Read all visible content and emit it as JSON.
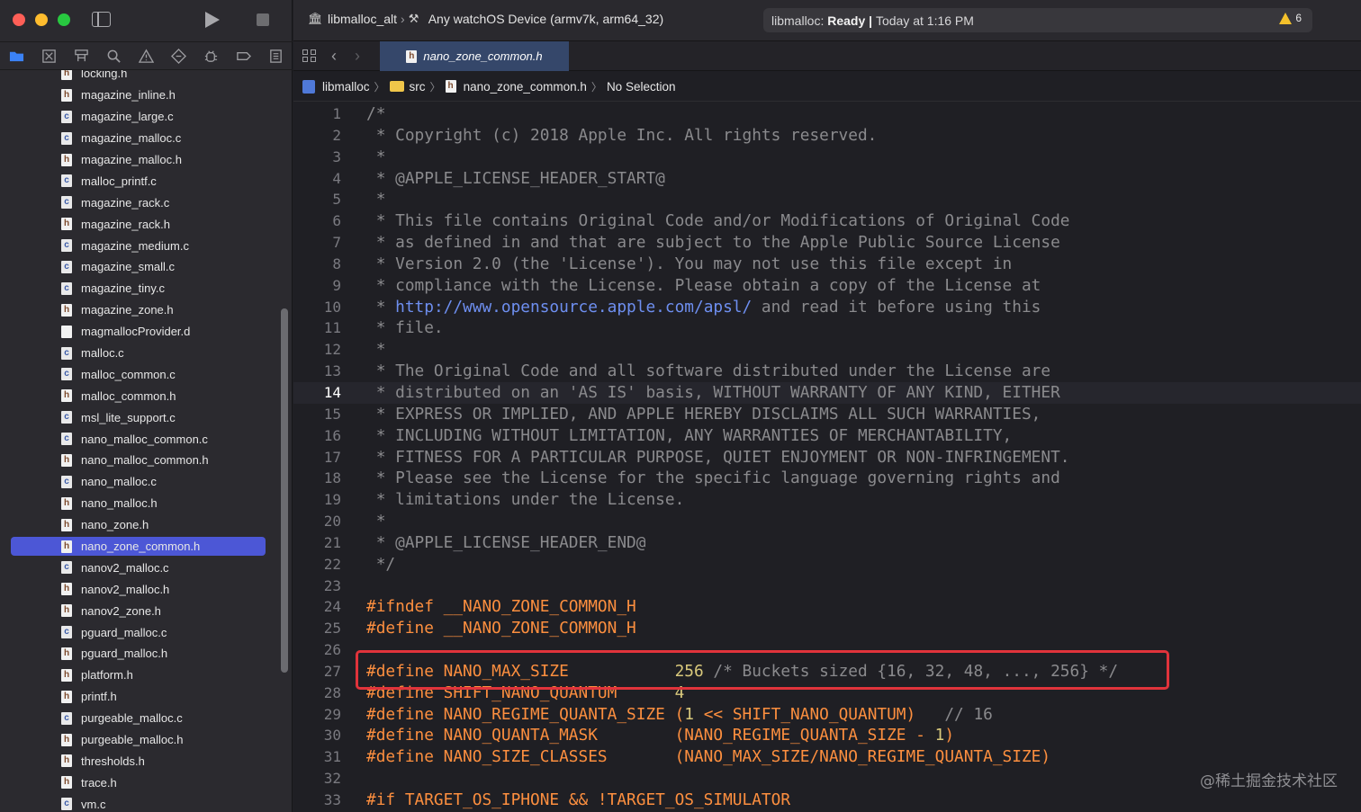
{
  "window": {
    "scheme_project": "libmalloc_alt",
    "scheme_device": "Any watchOS Device (armv7k, arm64_32)",
    "status_project": "libmalloc:",
    "status_state": "Ready",
    "status_separator": "|",
    "status_time": "Today at 1:16 PM",
    "warning_count": "6"
  },
  "icons": {
    "close": "close-dot",
    "minimize": "minimize-dot",
    "maximize": "maximize-dot",
    "sidebar": "sidebar-icon",
    "run": "play-icon",
    "stop": "stop-icon",
    "navigator_tabs": [
      "folder-icon",
      "source-control-icon",
      "symbol-icon",
      "search-icon",
      "issue-icon",
      "test-icon",
      "debug-icon",
      "breakpoint-icon",
      "report-icon"
    ]
  },
  "sidebar": {
    "files": [
      {
        "name": "locking.h",
        "type": "h"
      },
      {
        "name": "magazine_inline.h",
        "type": "h"
      },
      {
        "name": "magazine_large.c",
        "type": "c"
      },
      {
        "name": "magazine_malloc.c",
        "type": "c"
      },
      {
        "name": "magazine_malloc.h",
        "type": "h"
      },
      {
        "name": "malloc_printf.c",
        "type": "c"
      },
      {
        "name": "magazine_rack.c",
        "type": "c"
      },
      {
        "name": "magazine_rack.h",
        "type": "h"
      },
      {
        "name": "magazine_medium.c",
        "type": "c"
      },
      {
        "name": "magazine_small.c",
        "type": "c"
      },
      {
        "name": "magazine_tiny.c",
        "type": "c"
      },
      {
        "name": "magazine_zone.h",
        "type": "h"
      },
      {
        "name": "magmallocProvider.d",
        "type": "d"
      },
      {
        "name": "malloc.c",
        "type": "c"
      },
      {
        "name": "malloc_common.c",
        "type": "c"
      },
      {
        "name": "malloc_common.h",
        "type": "h"
      },
      {
        "name": "msl_lite_support.c",
        "type": "c"
      },
      {
        "name": "nano_malloc_common.c",
        "type": "c"
      },
      {
        "name": "nano_malloc_common.h",
        "type": "h"
      },
      {
        "name": "nano_malloc.c",
        "type": "c"
      },
      {
        "name": "nano_malloc.h",
        "type": "h"
      },
      {
        "name": "nano_zone.h",
        "type": "h"
      },
      {
        "name": "nano_zone_common.h",
        "type": "h",
        "selected": true
      },
      {
        "name": "nanov2_malloc.c",
        "type": "c"
      },
      {
        "name": "nanov2_malloc.h",
        "type": "h"
      },
      {
        "name": "nanov2_zone.h",
        "type": "h"
      },
      {
        "name": "pguard_malloc.c",
        "type": "c"
      },
      {
        "name": "pguard_malloc.h",
        "type": "h"
      },
      {
        "name": "platform.h",
        "type": "h"
      },
      {
        "name": "printf.h",
        "type": "h"
      },
      {
        "name": "purgeable_malloc.c",
        "type": "c"
      },
      {
        "name": "purgeable_malloc.h",
        "type": "h"
      },
      {
        "name": "thresholds.h",
        "type": "h"
      },
      {
        "name": "trace.h",
        "type": "h"
      },
      {
        "name": "vm.c",
        "type": "c"
      }
    ]
  },
  "editor": {
    "tab_label": "nano_zone_common.h",
    "breadcrumbs": [
      "libmalloc",
      "src",
      "nano_zone_common.h",
      "No Selection"
    ],
    "current_line": 14,
    "lines": [
      [
        {
          "t": "/*",
          "c": "comment"
        }
      ],
      [
        {
          "t": " * Copyright (c) 2018 Apple Inc. All rights reserved.",
          "c": "comment"
        }
      ],
      [
        {
          "t": " *",
          "c": "comment"
        }
      ],
      [
        {
          "t": " * @APPLE_LICENSE_HEADER_START@",
          "c": "comment"
        }
      ],
      [
        {
          "t": " *",
          "c": "comment"
        }
      ],
      [
        {
          "t": " * This file contains Original Code and/or Modifications of Original Code",
          "c": "comment"
        }
      ],
      [
        {
          "t": " * as defined in and that are subject to the Apple Public Source License",
          "c": "comment"
        }
      ],
      [
        {
          "t": " * Version 2.0 (the 'License'). You may not use this file except in",
          "c": "comment"
        }
      ],
      [
        {
          "t": " * compliance with the License. Please obtain a copy of the License at",
          "c": "comment"
        }
      ],
      [
        {
          "t": " * ",
          "c": "comment"
        },
        {
          "t": "http://www.opensource.apple.com/apsl/",
          "c": "link"
        },
        {
          "t": " and read it before using this",
          "c": "comment"
        }
      ],
      [
        {
          "t": " * file.",
          "c": "comment"
        }
      ],
      [
        {
          "t": " *",
          "c": "comment"
        }
      ],
      [
        {
          "t": " * The Original Code and all software distributed under the License are",
          "c": "comment"
        }
      ],
      [
        {
          "t": " * distributed on an 'AS IS' basis, WITHOUT WARRANTY OF ANY KIND, EITHER",
          "c": "comment"
        }
      ],
      [
        {
          "t": " * EXPRESS OR IMPLIED, AND APPLE HEREBY DISCLAIMS ALL SUCH WARRANTIES,",
          "c": "comment"
        }
      ],
      [
        {
          "t": " * INCLUDING WITHOUT LIMITATION, ANY WARRANTIES OF MERCHANTABILITY,",
          "c": "comment"
        }
      ],
      [
        {
          "t": " * FITNESS FOR A PARTICULAR PURPOSE, QUIET ENJOYMENT OR NON-INFRINGEMENT.",
          "c": "comment"
        }
      ],
      [
        {
          "t": " * Please see the License for the specific language governing rights and",
          "c": "comment"
        }
      ],
      [
        {
          "t": " * limitations under the License.",
          "c": "comment"
        }
      ],
      [
        {
          "t": " *",
          "c": "comment"
        }
      ],
      [
        {
          "t": " * @APPLE_LICENSE_HEADER_END@",
          "c": "comment"
        }
      ],
      [
        {
          "t": " */",
          "c": "comment"
        }
      ],
      [],
      [
        {
          "t": "#ifndef __NANO_ZONE_COMMON_H",
          "c": "pre"
        }
      ],
      [
        {
          "t": "#define __NANO_ZONE_COMMON_H",
          "c": "pre"
        }
      ],
      [],
      [
        {
          "t": "#define NANO_MAX_SIZE           ",
          "c": "pre"
        },
        {
          "t": "256",
          "c": "num"
        },
        {
          "t": " /* Buckets sized {16, 32, 48, ..., 256} */",
          "c": "comment"
        }
      ],
      [
        {
          "t": "#define SHIFT_NANO_QUANTUM      ",
          "c": "pre"
        },
        {
          "t": "4",
          "c": "num"
        }
      ],
      [
        {
          "t": "#define NANO_REGIME_QUANTA_SIZE (",
          "c": "pre"
        },
        {
          "t": "1",
          "c": "num"
        },
        {
          "t": " << SHIFT_NANO_QUANTUM)   ",
          "c": "pre"
        },
        {
          "t": "// 16",
          "c": "comment"
        }
      ],
      [
        {
          "t": "#define NANO_QUANTA_MASK        (NANO_REGIME_QUANTA_SIZE - ",
          "c": "pre"
        },
        {
          "t": "1",
          "c": "num"
        },
        {
          "t": ")",
          "c": "pre"
        }
      ],
      [
        {
          "t": "#define NANO_SIZE_CLASSES       (NANO_MAX_SIZE/NANO_REGIME_QUANTA_SIZE)",
          "c": "pre"
        }
      ],
      [],
      [
        {
          "t": "#if TARGET_OS_IPHONE && !TARGET_OS_SIMULATOR",
          "c": "pre"
        }
      ]
    ]
  },
  "watermark": "@稀土掘金技术社区"
}
